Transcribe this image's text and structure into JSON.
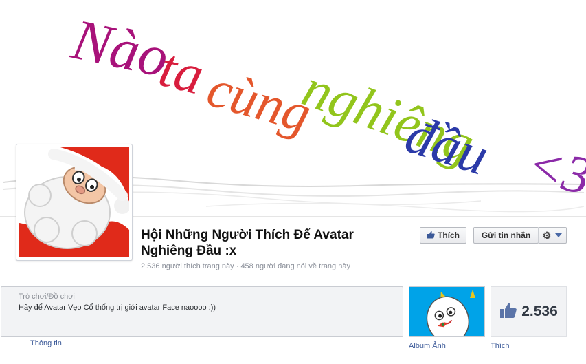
{
  "cover": {
    "words": [
      {
        "text": "Nào",
        "color": "#a8127a"
      },
      {
        "text": "ta",
        "color": "#d81d3d"
      },
      {
        "text": "cùng",
        "color": "#e4572c"
      },
      {
        "text": "nghiêng",
        "color": "#92c51c"
      },
      {
        "text": "đầu",
        "color": "#2b3aa8"
      },
      {
        "text": "<3",
        "color": "#8b2aa8"
      }
    ]
  },
  "page": {
    "title": "Hội Những Người Thích Để Avatar Nghiêng Đầu :x",
    "stats": "2.536 người thích trang này · 458 người đang nói về trang này"
  },
  "actions": {
    "like_label": "Thích",
    "message_label": "Gửi tin nhắn",
    "like_icon": "thumbs-up-icon",
    "gear_icon": "gear-icon"
  },
  "info": {
    "category": "Trò chơi/Đồ chơi",
    "description": "Hãy để Avatar Vẹo Cổ thống trị giới avatar Face naoooo :))",
    "label": "Thông tin"
  },
  "album": {
    "label": "Album Ảnh"
  },
  "likes": {
    "count": "2.536",
    "label": "Thích",
    "icon": "thumbs-up-icon"
  },
  "colors": {
    "link": "#3b5998",
    "accent": "#4b6aa7"
  }
}
